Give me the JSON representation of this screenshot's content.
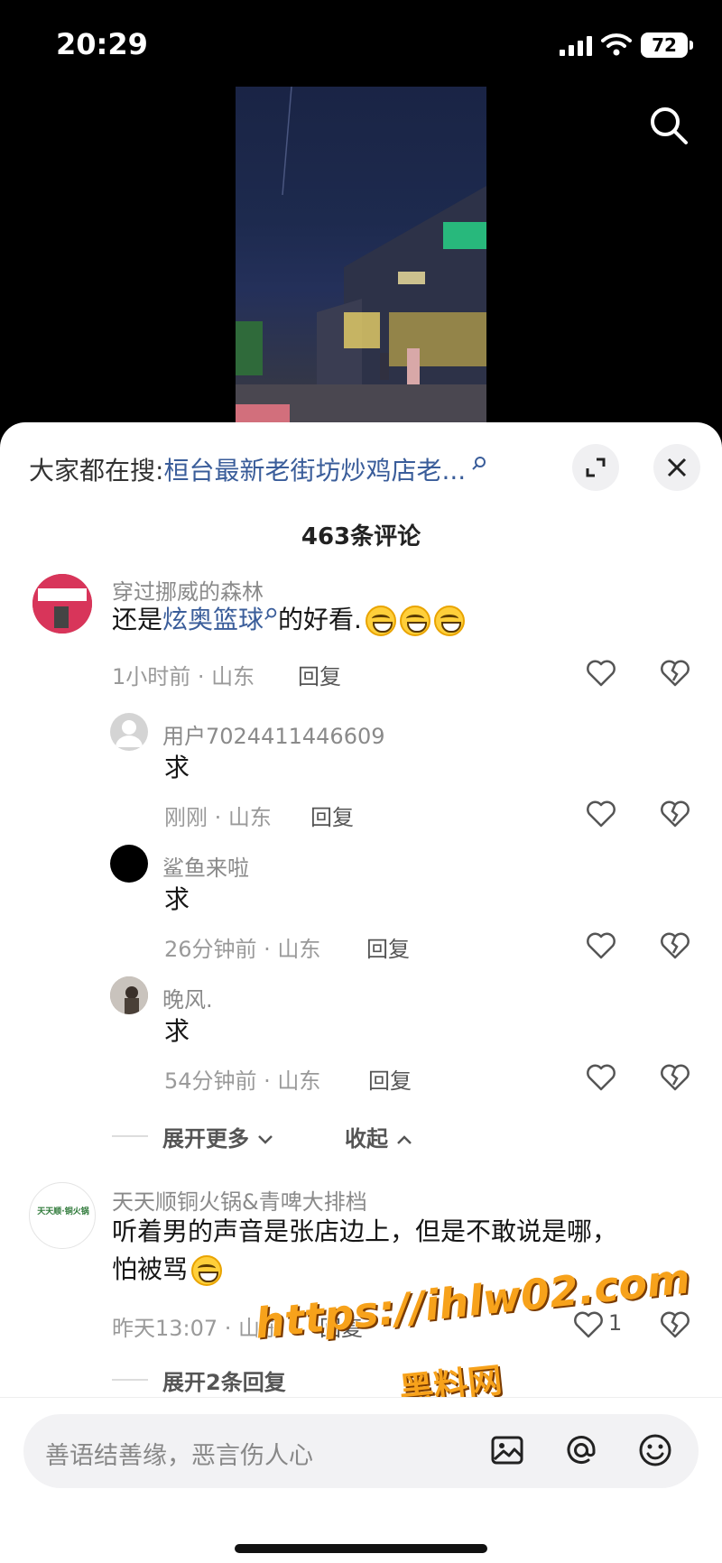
{
  "status_bar": {
    "time": "20:29",
    "battery": "72"
  },
  "panel": {
    "search_prefix": "大家都在搜:",
    "search_keyword": "桓台最新老街坊炒鸡店老...",
    "comment_count": "463条评论"
  },
  "comments": [
    {
      "name": "穿过挪威的森林",
      "text_prefix": "还是",
      "text_link": "炫奥篮球",
      "text_suffix": "的好看.",
      "meta": "1小时前 · 山东",
      "reply": "回复"
    },
    {
      "name": "用户7024411446609",
      "text": "求",
      "meta": "刚刚 · 山东",
      "reply": "回复"
    },
    {
      "name": "鲨鱼来啦",
      "text": "求",
      "meta": "26分钟前 · 山东",
      "reply": "回复"
    },
    {
      "name": "晚风.",
      "text": "求",
      "meta": "54分钟前 · 山东",
      "reply": "回复"
    },
    {
      "name": "天天顺铜火锅&青啤大排档",
      "text_line1": "听着男的声音是张店边上，但是不敢说是哪，",
      "text_line2": "怕被骂",
      "meta": "昨天13:07 · 山东",
      "reply": "回复",
      "likes": "1",
      "avatar_text": "天天顺·铜火锅"
    }
  ],
  "thread": {
    "expand_more": "展开更多",
    "collapse": "收起",
    "expand_two": "展开2条回复"
  },
  "input": {
    "placeholder": "善语结善缘，恶言伤人心"
  },
  "watermark": {
    "url": "https://ihlw02.com",
    "name": "黑料网"
  },
  "colors": {
    "link": "#3a5d9a",
    "watermark": "#f7a21b"
  }
}
